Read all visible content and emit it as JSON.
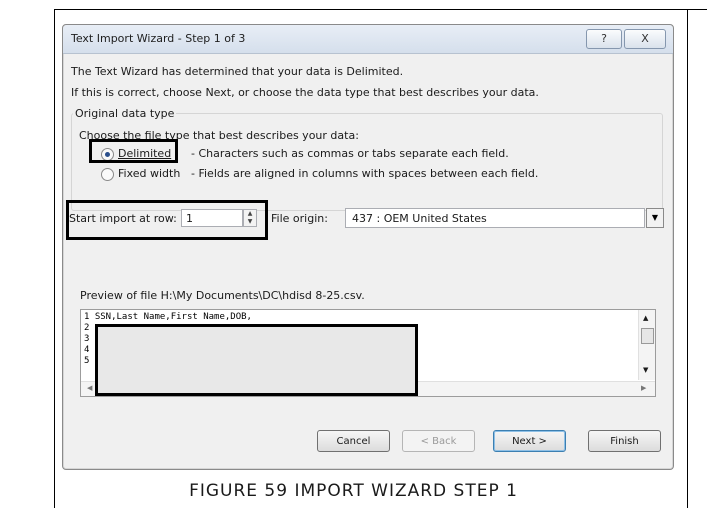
{
  "dialog": {
    "title": "Text Import Wizard - Step 1 of 3",
    "help_label": "?",
    "close_label": "X",
    "intro_line1": "The Text Wizard has determined that your data is Delimited.",
    "intro_line2": "If this is correct, choose Next, or choose the data type that best describes your data.",
    "group_title": "Original data type",
    "group_prompt": "Choose the file type that best describes your data:",
    "options": [
      {
        "label": "Delimited",
        "description": "- Characters such as commas or tabs separate each field.",
        "selected": true
      },
      {
        "label": "Fixed width",
        "description": "- Fields are aligned in columns with spaces between each field.",
        "selected": false
      }
    ],
    "start_row_label": "Start import at row:",
    "start_row_value": "1",
    "file_origin_label": "File origin:",
    "file_origin_value": "437 : OEM United States",
    "preview_label": "Preview of file H:\\My Documents\\DC\\hdisd 8-25.csv.",
    "preview_lines": [
      "1 SSN,Last Name,First Name,DOB,",
      "2",
      "3",
      "4",
      "5"
    ],
    "buttons": {
      "cancel": "Cancel",
      "back": "< Back",
      "next": "Next >",
      "finish": "Finish"
    }
  },
  "caption": "FIGURE 59 IMPORT WIZARD STEP 1"
}
